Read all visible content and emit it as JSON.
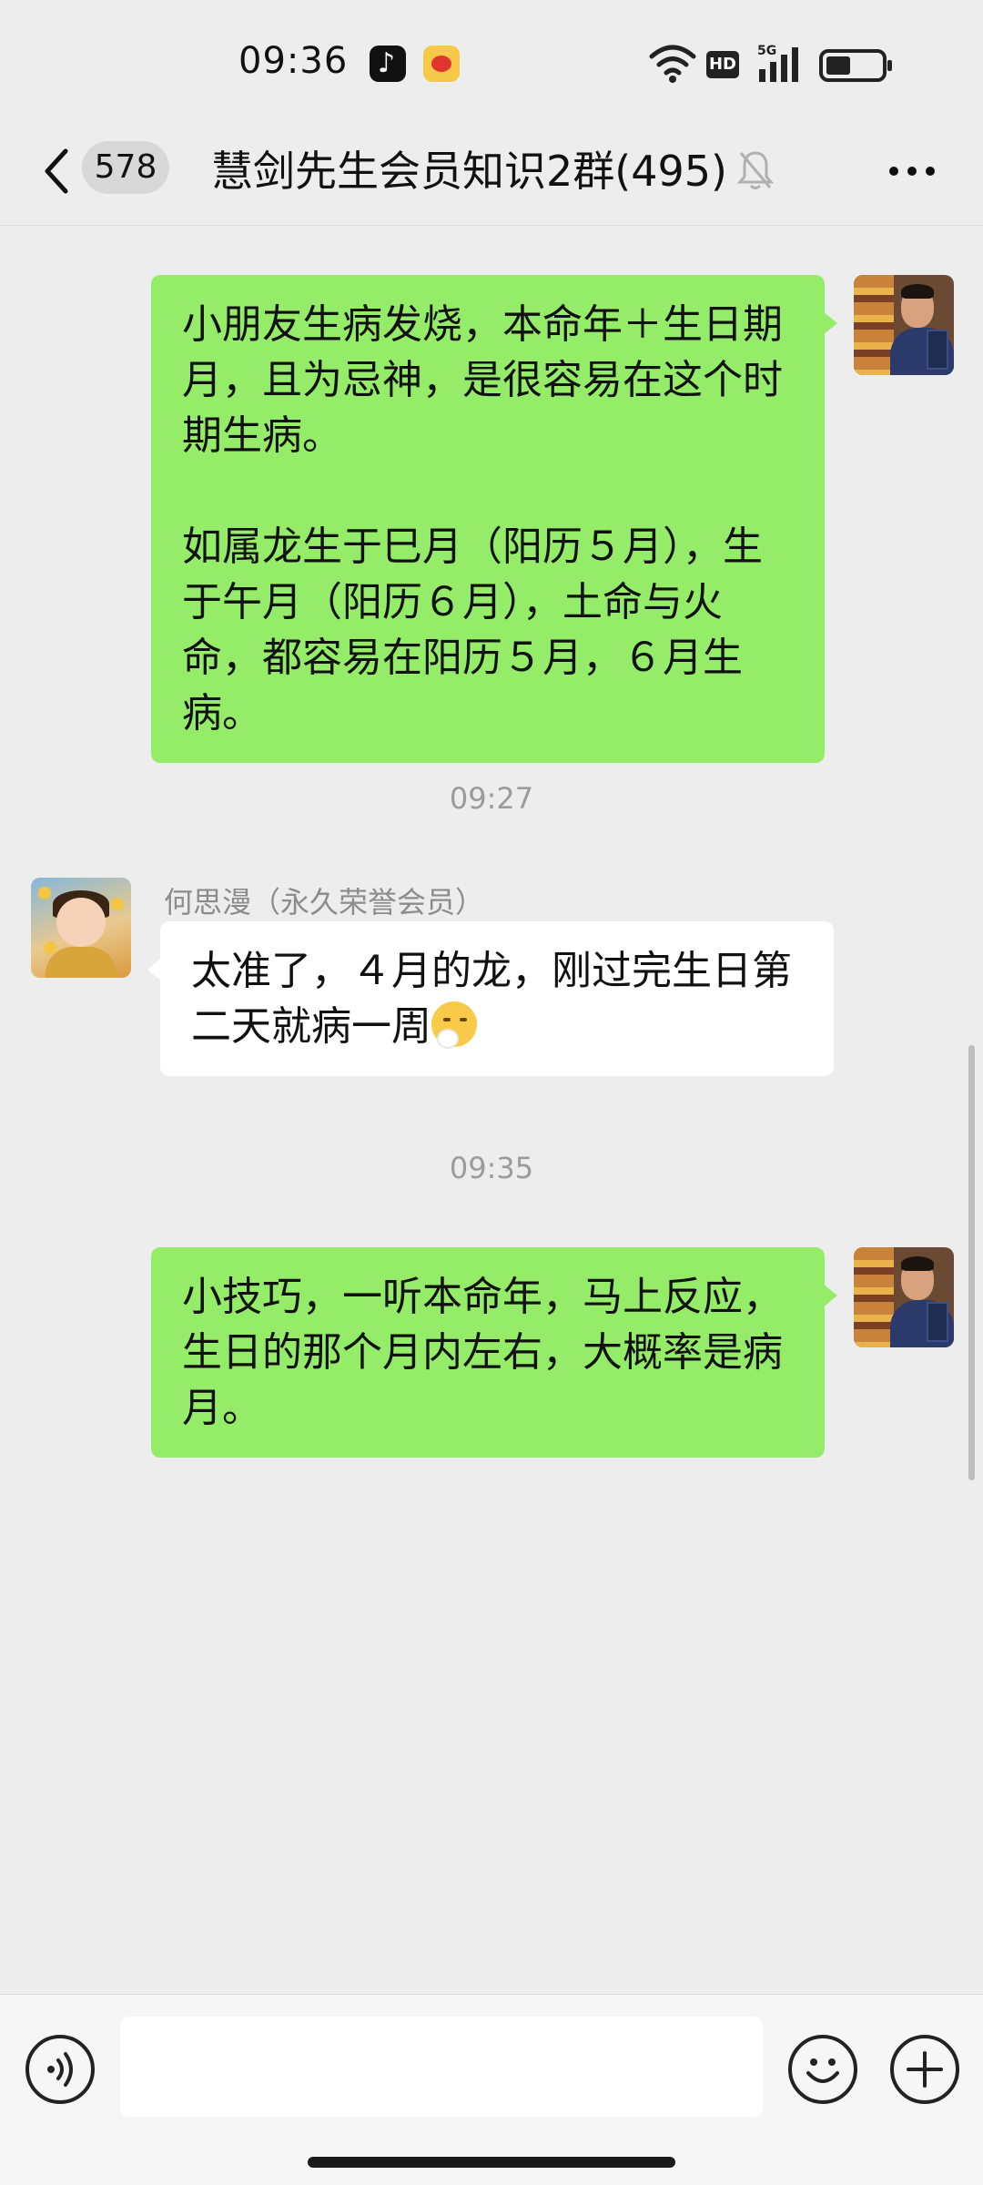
{
  "status_bar": {
    "time": "09:36",
    "apps": [
      "tiktok-icon",
      "weibo-icon"
    ],
    "network_label": "HD",
    "signal_label": "5G"
  },
  "header": {
    "unread_count": "578",
    "title": "慧剑先生会员知识2群(495)",
    "icons": [
      "back-icon",
      "mute-bell-icon",
      "more-icon"
    ]
  },
  "messages": [
    {
      "side": "self",
      "text": "小朋友生病发烧，本命年＋生日期月，且为忌神，是很容易在这个时期生病。\n\n如属龙生于巳月（阳历５月），生于午月（阳历６月），土命与火命，都容易在阳历５月，６月生病。"
    },
    {
      "time": "09:27"
    },
    {
      "side": "other",
      "sender": "何思漫（永久荣誉会员）",
      "text": "太准了，４月的龙，刚过完生日第二天就病一周",
      "emoji": "shushing-face-emoji"
    },
    {
      "time": "09:35"
    },
    {
      "side": "self",
      "text": "小技巧，一听本命年，马上反应，生日的那个月内左右，大概率是病月。"
    }
  ],
  "input_bar": {
    "icons": [
      "voice-icon",
      "emoji-icon",
      "plus-icon"
    ],
    "input_value": ""
  },
  "colors": {
    "background": "#ededed",
    "self_bubble": "#95ec69",
    "other_bubble": "#ffffff",
    "timestamp_text": "#9b9b9b"
  }
}
